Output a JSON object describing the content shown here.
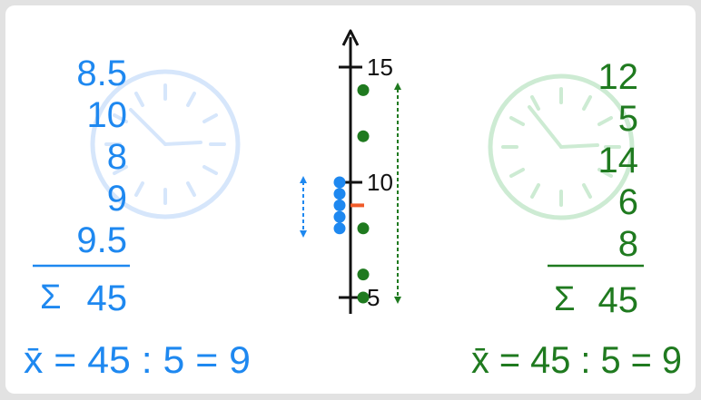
{
  "colors": {
    "blue": "#1e88f0",
    "green": "#1f7a1f",
    "axis": "#111111",
    "mean_marker": "#f05a28",
    "clock_blue": "#d6e6fb",
    "clock_green": "#cdebd3"
  },
  "icons": [
    "clock-icon",
    "clock-icon"
  ],
  "left": {
    "values": [
      "8.5",
      "10",
      "8",
      "9",
      "9.5"
    ],
    "sum_symbol": "Σ",
    "sum": "45",
    "mean_formula": "x̄ = 45 : 5 = 9"
  },
  "right": {
    "values": [
      "12",
      "5",
      "14",
      "6",
      "8"
    ],
    "sum_symbol": "Σ",
    "sum": "45",
    "mean_formula": "x̄ = 45 : 5 = 9"
  },
  "chart_data": {
    "type": "scatter",
    "axis": {
      "ticks": [
        5,
        10,
        15
      ],
      "range": [
        4.5,
        16.5
      ]
    },
    "series": [
      {
        "color": "blue",
        "values": [
          8.5,
          10,
          8,
          9,
          9.5
        ]
      },
      {
        "color": "green",
        "values": [
          12,
          5,
          14,
          6,
          8
        ]
      }
    ],
    "mean": 9
  }
}
